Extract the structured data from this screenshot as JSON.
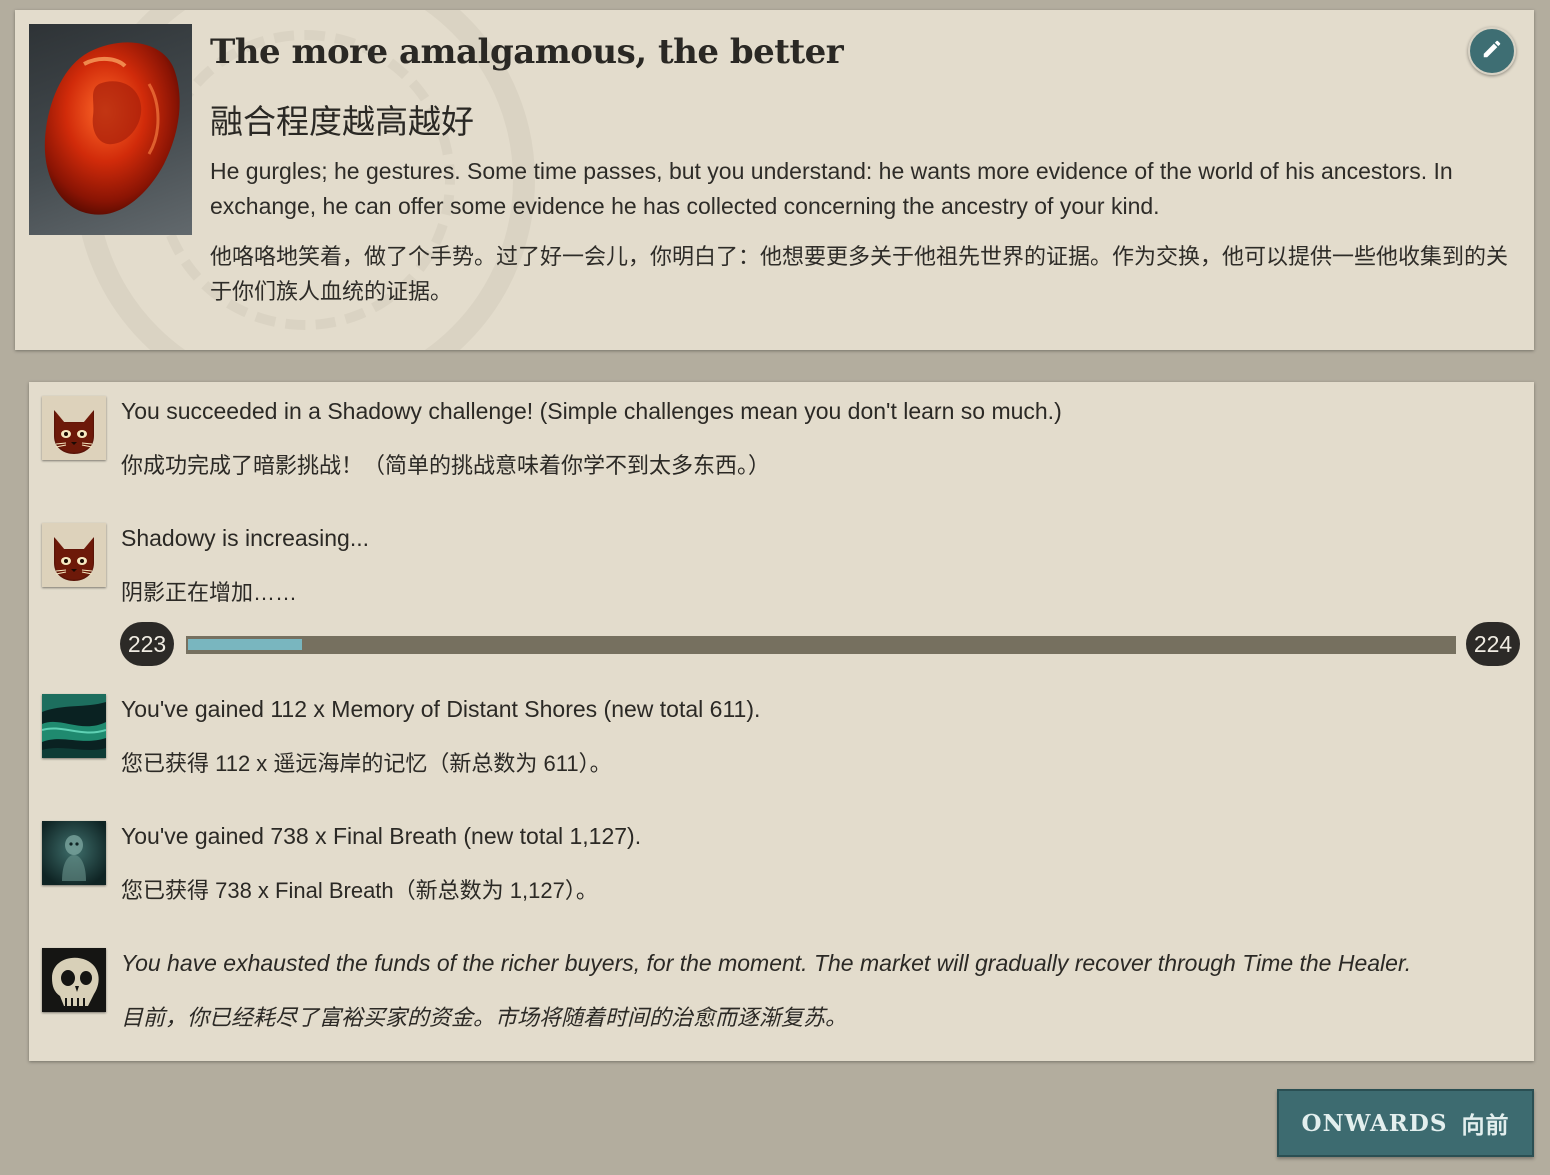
{
  "story": {
    "title": "The more amalgamous, the better",
    "title_zh": "融合程度越高越好",
    "description": "He gurgles; he gestures. Some time passes, but you understand: he wants more evidence of the world of his ancestors. In exchange, he can offer some evidence he has collected concerning the ancestry of your kind.",
    "description_zh": "他咯咯地笑着，做了个手势。过了好一会儿，你明白了：他想要更多关于他祖先世界的证据。作为交换，他可以提供一些他收集到的关于你们族人血统的证据。",
    "image_icon": "amber-gem-icon",
    "edit_icon": "pencil-icon"
  },
  "results": [
    {
      "icon": "shadowy-cat-icon",
      "text": "You succeeded in a Shadowy challenge! (Simple challenges mean you don't learn so much.)",
      "text_zh": "你成功完成了暗影挑战！（简单的挑战意味着你学不到太多东西。）"
    },
    {
      "icon": "shadowy-cat-icon",
      "text": "Shadowy is increasing...",
      "text_zh": "阴影正在增加……",
      "progress": {
        "start": "223",
        "end": "224",
        "fraction": 0.09
      }
    },
    {
      "icon": "distant-shores-icon",
      "text": "You've gained 112 x Memory of Distant Shores (new total 611).",
      "text_zh": "您已获得 112 x 遥远海岸的记忆（新总数为 611）。"
    },
    {
      "icon": "final-breath-icon",
      "text": "You've gained 738 x Final Breath (new total 1,127).",
      "text_zh": "您已获得 738 x Final Breath（新总数为 1,127）。"
    },
    {
      "icon": "skull-icon",
      "text": "You have exhausted the funds of the richer buyers, for the moment. The market will gradually recover through Time the Healer.",
      "text_zh": "目前，你已经耗尽了富裕买家的资金。市场将随着时间的治愈而逐渐复苏。"
    }
  ],
  "onwards": {
    "label": "ONWARDS",
    "label_zh": "向前"
  },
  "colors": {
    "accent": "#3d6b70",
    "progress_fill": "#79b6bf",
    "paper": "#e3dccc",
    "background": "#b3ad9e"
  }
}
